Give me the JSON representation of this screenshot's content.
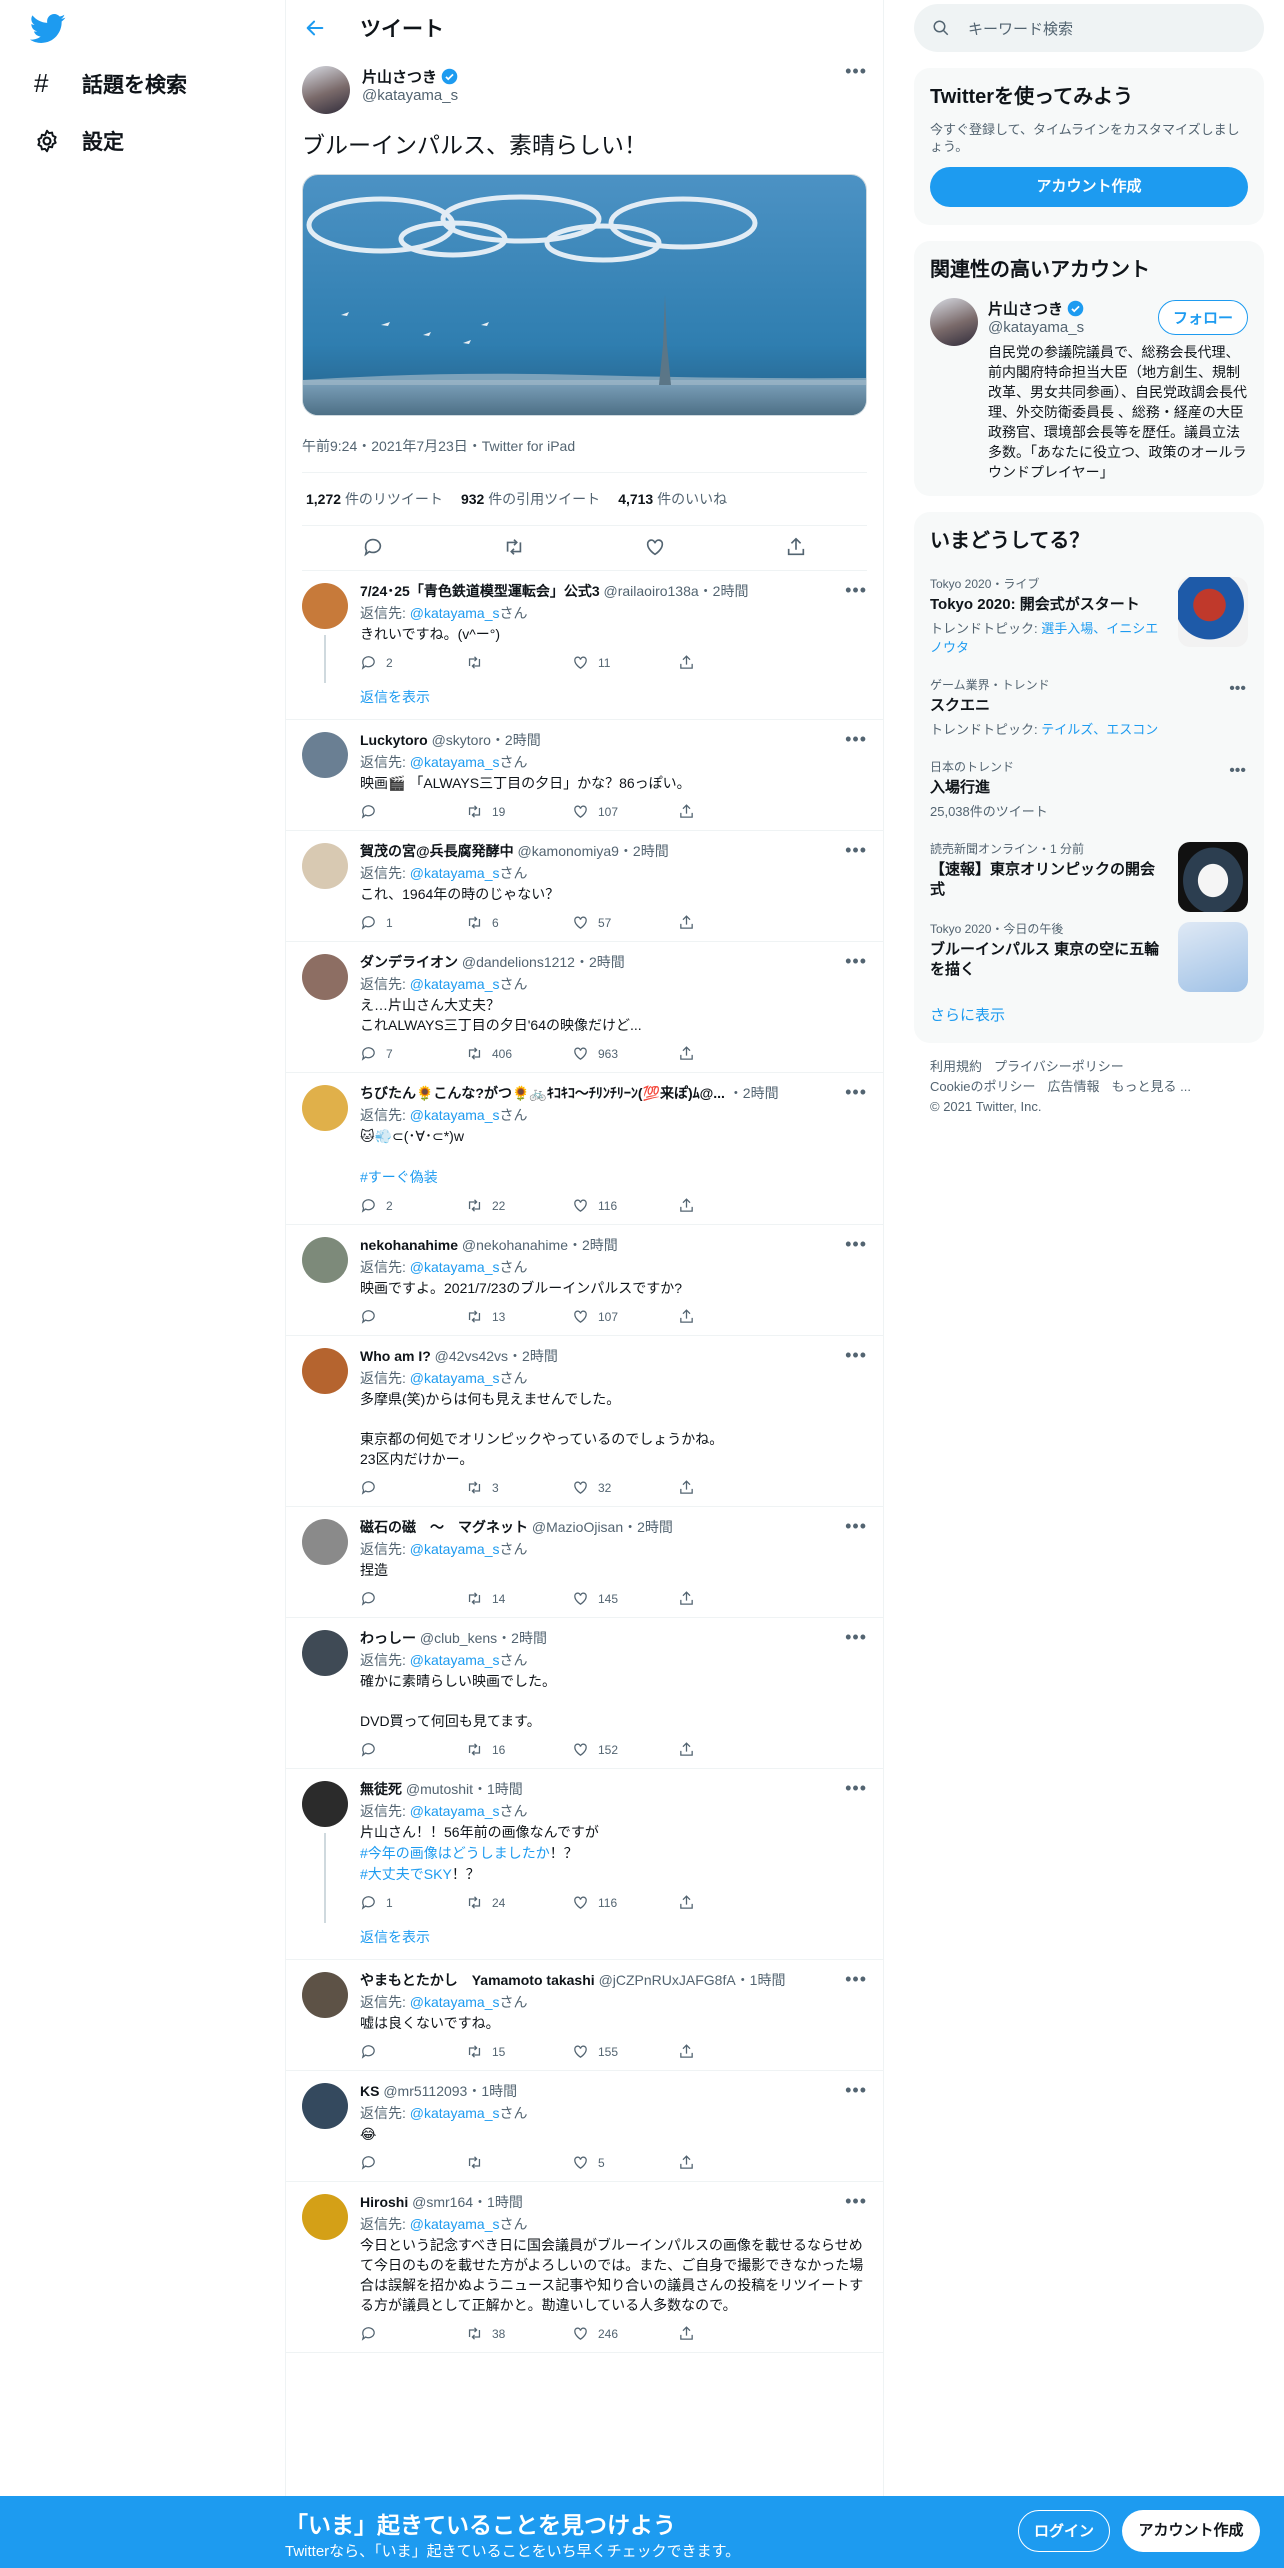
{
  "nav": {
    "explore": "話題を検索",
    "settings": "設定"
  },
  "header": {
    "title": "ツイート"
  },
  "main_tweet": {
    "name": "片山さつき",
    "handle": "@katayama_s",
    "text": "ブルーインパルス、素晴らしい！",
    "meta": "午前9:24・2021年7月23日・Twitter for iPad",
    "retweets_count": "1,272",
    "retweets_label": "件のリツイート",
    "quotes_count": "932",
    "quotes_label": "件の引用ツイート",
    "likes_count": "4,713",
    "likes_label": "件のいいね"
  },
  "reply_prefix": "返信先: ",
  "reply_to": "@katayama_s",
  "reply_suffix": "さん",
  "replies": [
    {
      "name": "7/24･25「青色鉄道模型運転会」公式3",
      "handle": "@railaoiro138a",
      "time": "・2時間",
      "text": "きれいですね。(v^ー°)",
      "c": "2",
      "rt": "",
      "lk": "11",
      "showmore": "返信を表示"
    },
    {
      "name": "Luckytoro",
      "handle": "@skytoro",
      "time": "・2時間",
      "text": "映画🎬 「ALWAYS三丁目の夕日」かな？86っぽい。",
      "c": "",
      "rt": "19",
      "lk": "107"
    },
    {
      "name": "賀茂の宮@兵長腐発酵中",
      "handle": "@kamonomiya9",
      "time": "・2時間",
      "text": "これ、1964年の時のじゃない？",
      "c": "1",
      "rt": "6",
      "lk": "57"
    },
    {
      "name": "ダンデライオン",
      "handle": "@dandelions1212",
      "time": "・2時間",
      "text": "え…片山さん大丈夫？\nこれALWAYS三丁目の夕日'64の映像だけど...",
      "c": "7",
      "rt": "406",
      "lk": "963"
    },
    {
      "name": "ちびたん🌻こんな?がつ🌻🚲ｷｺｷｺ〜ﾁﾘﾝﾁﾘｰﾝ(💯来ぽ)ﾑ@...",
      "handle": "",
      "time": "・2時間",
      "text": "🐱💨⊂(･∀･⊂*)w\n\n",
      "tag": "#すーぐ偽装",
      "c": "2",
      "rt": "22",
      "lk": "116"
    },
    {
      "name": "nekohanahime",
      "handle": "@nekohanahime",
      "time": "・2時間",
      "text": "映画ですよ。2021/7/23のブルーインパルスですか?",
      "c": "",
      "rt": "13",
      "lk": "107"
    },
    {
      "name": "Who am I?",
      "handle": "@42vs42vs",
      "time": "・2時間",
      "text": "多摩県(笑)からは何も見えませんでした。\n\n東京都の何処でオリンピックやっているのでしょうかね。\n23区内だけかー。",
      "c": "",
      "rt": "3",
      "lk": "32"
    },
    {
      "name": "磁石の磁　〜　マグネット",
      "handle": "@MazioOjisan",
      "time": "・2時間",
      "text": "捏造",
      "c": "",
      "rt": "14",
      "lk": "145"
    },
    {
      "name": "わっしー",
      "handle": "@club_kens",
      "time": "・2時間",
      "text": "確かに素晴らしい映画でした。\n\nDVD買って何回も見てます。",
      "c": "",
      "rt": "16",
      "lk": "152"
    },
    {
      "name": "無徒死",
      "handle": "@mutoshit",
      "time": "・1時間",
      "text": "片山さん！！56年前の画像なんですが",
      "tags": [
        "#今年の画像はどうしましたか",
        "#大丈夫でSKY"
      ],
      "tag_suffix": [
        "！？",
        "！？"
      ],
      "c": "1",
      "rt": "24",
      "lk": "116",
      "showmore": "返信を表示"
    },
    {
      "name": "やまもとたかし　Yamamoto takashi",
      "handle": "@jCZPnRUxJAFG8fA",
      "time": "・1時間",
      "text": "嘘は良くないですね。",
      "c": "",
      "rt": "15",
      "lk": "155"
    },
    {
      "name": "KS",
      "handle": "@mr5112093",
      "time": "・1時間",
      "text": "😂",
      "c": "",
      "rt": "",
      "lk": "5"
    },
    {
      "name": "Hiroshi",
      "handle": "@smr164",
      "time": "・1時間",
      "text": "今日という記念すべき日に国会議員がブルーインパルスの画像を載せるならせめて今日のものを載せた方がよろしいのでは。また、ご自身で撮影できなかった場合は誤解を招かぬようニュース記事や知り合いの議員さんの投稿をリツイートする方が議員として正解かと。勘違いしている人多数なので。",
      "c": "",
      "rt": "38",
      "lk": "246"
    }
  ],
  "right": {
    "search_placeholder": "キーワード検索",
    "signup_title": "Twitterを使ってみよう",
    "signup_desc": "今すぐ登録して、タイムラインをカスタマイズしましょう。",
    "signup_button": "アカウント作成",
    "relevant_title": "関連性の高いアカウント",
    "rel_name": "片山さつき",
    "rel_handle": "@katayama_s",
    "follow": "フォロー",
    "rel_bio": "自民党の参議院議員で、総務会長代理、前内閣府特命担当大臣（地方創生、規制改革、男女共同参画）、自民党政調会長代理、外交防衛委員長 、総務・経産の大臣政務官、環境部会長等を歴任。議員立法多数。「あなたに役立つ、政策のオールラウンドプレイヤー」",
    "trends_title": "いまどうしてる？",
    "trends": [
      {
        "ctx": "Tokyo 2020・ライブ",
        "title": "Tokyo 2020: 開会式がスタート",
        "sub_prefix": "トレンドトピック: ",
        "sub_links": "選手入場、イニシエノウタ",
        "thumb": true
      },
      {
        "ctx": "ゲーム業界・トレンド",
        "title": "スクエニ",
        "sub_prefix": "トレンドトピック: ",
        "sub_links": "テイルズ、エスコン",
        "dots": true
      },
      {
        "ctx": "日本のトレンド",
        "title": "入場行進",
        "sub_prefix": "25,038件のツイート",
        "sub_links": "",
        "dots": true
      },
      {
        "ctx": "読売新聞オンライン・1 分前",
        "title": "【速報】東京オリンピックの開会式",
        "sub_prefix": "",
        "sub_links": "",
        "thumb": true
      },
      {
        "ctx": "Tokyo 2020・今日の午後",
        "title": "ブルーインパルス 東京の空に五輪を描く",
        "sub_prefix": "",
        "sub_links": "",
        "thumb": true
      }
    ],
    "show_more": "さらに表示",
    "footer": [
      "利用規約",
      "プライバシーポリシー",
      "Cookieのポリシー",
      "広告情報",
      "もっと見る ...",
      "© 2021 Twitter, Inc."
    ]
  },
  "bottombar": {
    "headline": "「いま」起きていることを見つけよう",
    "sub": "Twitterなら、「いま」起きていることをいち早くチェックできます。",
    "login": "ログイン",
    "signup": "アカウント作成"
  },
  "colors": {
    "accent": "#1d9bf0",
    "text": "#0f1419",
    "muted": "#536471"
  }
}
